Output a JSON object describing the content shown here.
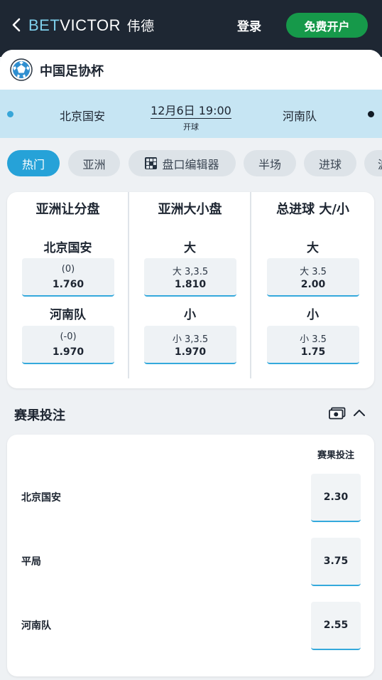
{
  "header": {
    "brand_bet": "BET",
    "brand_victor": "VICTOR",
    "brand_cn": "伟德",
    "login_label": "登录",
    "signup_label": "免费开户"
  },
  "competition": {
    "title": "中国足协杯"
  },
  "match": {
    "home": "北京国安",
    "away": "河南队",
    "kickoff_time": "12月6日 19:00",
    "kickoff_label": "开球"
  },
  "tabs": [
    "热门",
    "亚洲",
    "盘口编辑器",
    "半场",
    "进球",
    "波"
  ],
  "markets": [
    {
      "title": "亚洲让分盘",
      "selections": [
        {
          "label": "北京国安",
          "line": "(0)",
          "price": "1.760"
        },
        {
          "label": "河南队",
          "line": "(-0)",
          "price": "1.970"
        }
      ]
    },
    {
      "title": "亚洲大小盘",
      "selections": [
        {
          "label": "大",
          "line": "大 3,3.5",
          "price": "1.810"
        },
        {
          "label": "小",
          "line": "小 3,3.5",
          "price": "1.970"
        }
      ]
    },
    {
      "title": "总进球 大/小",
      "selections": [
        {
          "label": "大",
          "line": "大 3.5",
          "price": "2.00"
        },
        {
          "label": "小",
          "line": "小 3.5",
          "price": "1.75"
        }
      ]
    }
  ],
  "match_result": {
    "title": "赛果投注",
    "column_header": "赛果投注",
    "rows": [
      {
        "name": "北京国安",
        "price": "2.30"
      },
      {
        "name": "平局",
        "price": "3.75"
      },
      {
        "name": "河南队",
        "price": "2.55"
      }
    ]
  },
  "colors": {
    "header_bg": "#1e2733",
    "brand_accent": "#7fd0ec",
    "signup_green": "#16994a",
    "active_tab": "#26a2d8",
    "match_band": "#c6e5f3",
    "home_dot": "#38a6d8",
    "away_dot": "#111a24",
    "odds_underline": "#34a9dc"
  },
  "icons": [
    "chevron-left-icon",
    "football-icon",
    "grid-icon",
    "cash-icon",
    "chevron-up-icon"
  ]
}
